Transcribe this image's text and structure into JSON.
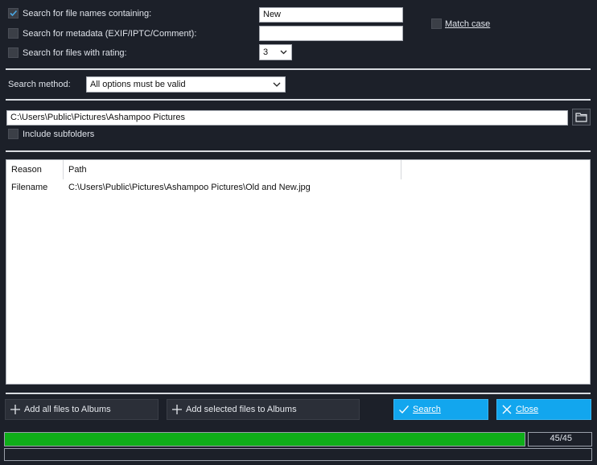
{
  "criteria": {
    "filename": {
      "label": "Search for file names containing:",
      "checked": true,
      "value": "New"
    },
    "metadata": {
      "label": "Search for metadata (EXIF/IPTC/Comment):",
      "checked": false,
      "value": ""
    },
    "rating": {
      "label": "Search for files with rating:",
      "checked": false,
      "value": "3"
    },
    "match_case": {
      "label": "Match case",
      "checked": false
    }
  },
  "search_method": {
    "label": "Search method:",
    "value": "All options must be valid"
  },
  "folder": {
    "path": "C:\\Users\\Public\\Pictures\\Ashampoo Pictures",
    "include_subfolders_label": "Include subfolders",
    "include_subfolders_checked": false
  },
  "results": {
    "columns": [
      "Reason",
      "Path"
    ],
    "rows": [
      {
        "reason": "Filename",
        "path": "C:\\Users\\Public\\Pictures\\Ashampoo Pictures\\Old and New.jpg"
      }
    ]
  },
  "buttons": {
    "add_all": "Add all files to Albums",
    "add_selected": "Add selected files to Albums",
    "search": "Search",
    "close": "Close"
  },
  "progress": {
    "fraction": 1.0,
    "counter": "45/45"
  },
  "colors": {
    "background": "#1c2029",
    "accent": "#12a6ee",
    "progress": "#0fae19"
  }
}
